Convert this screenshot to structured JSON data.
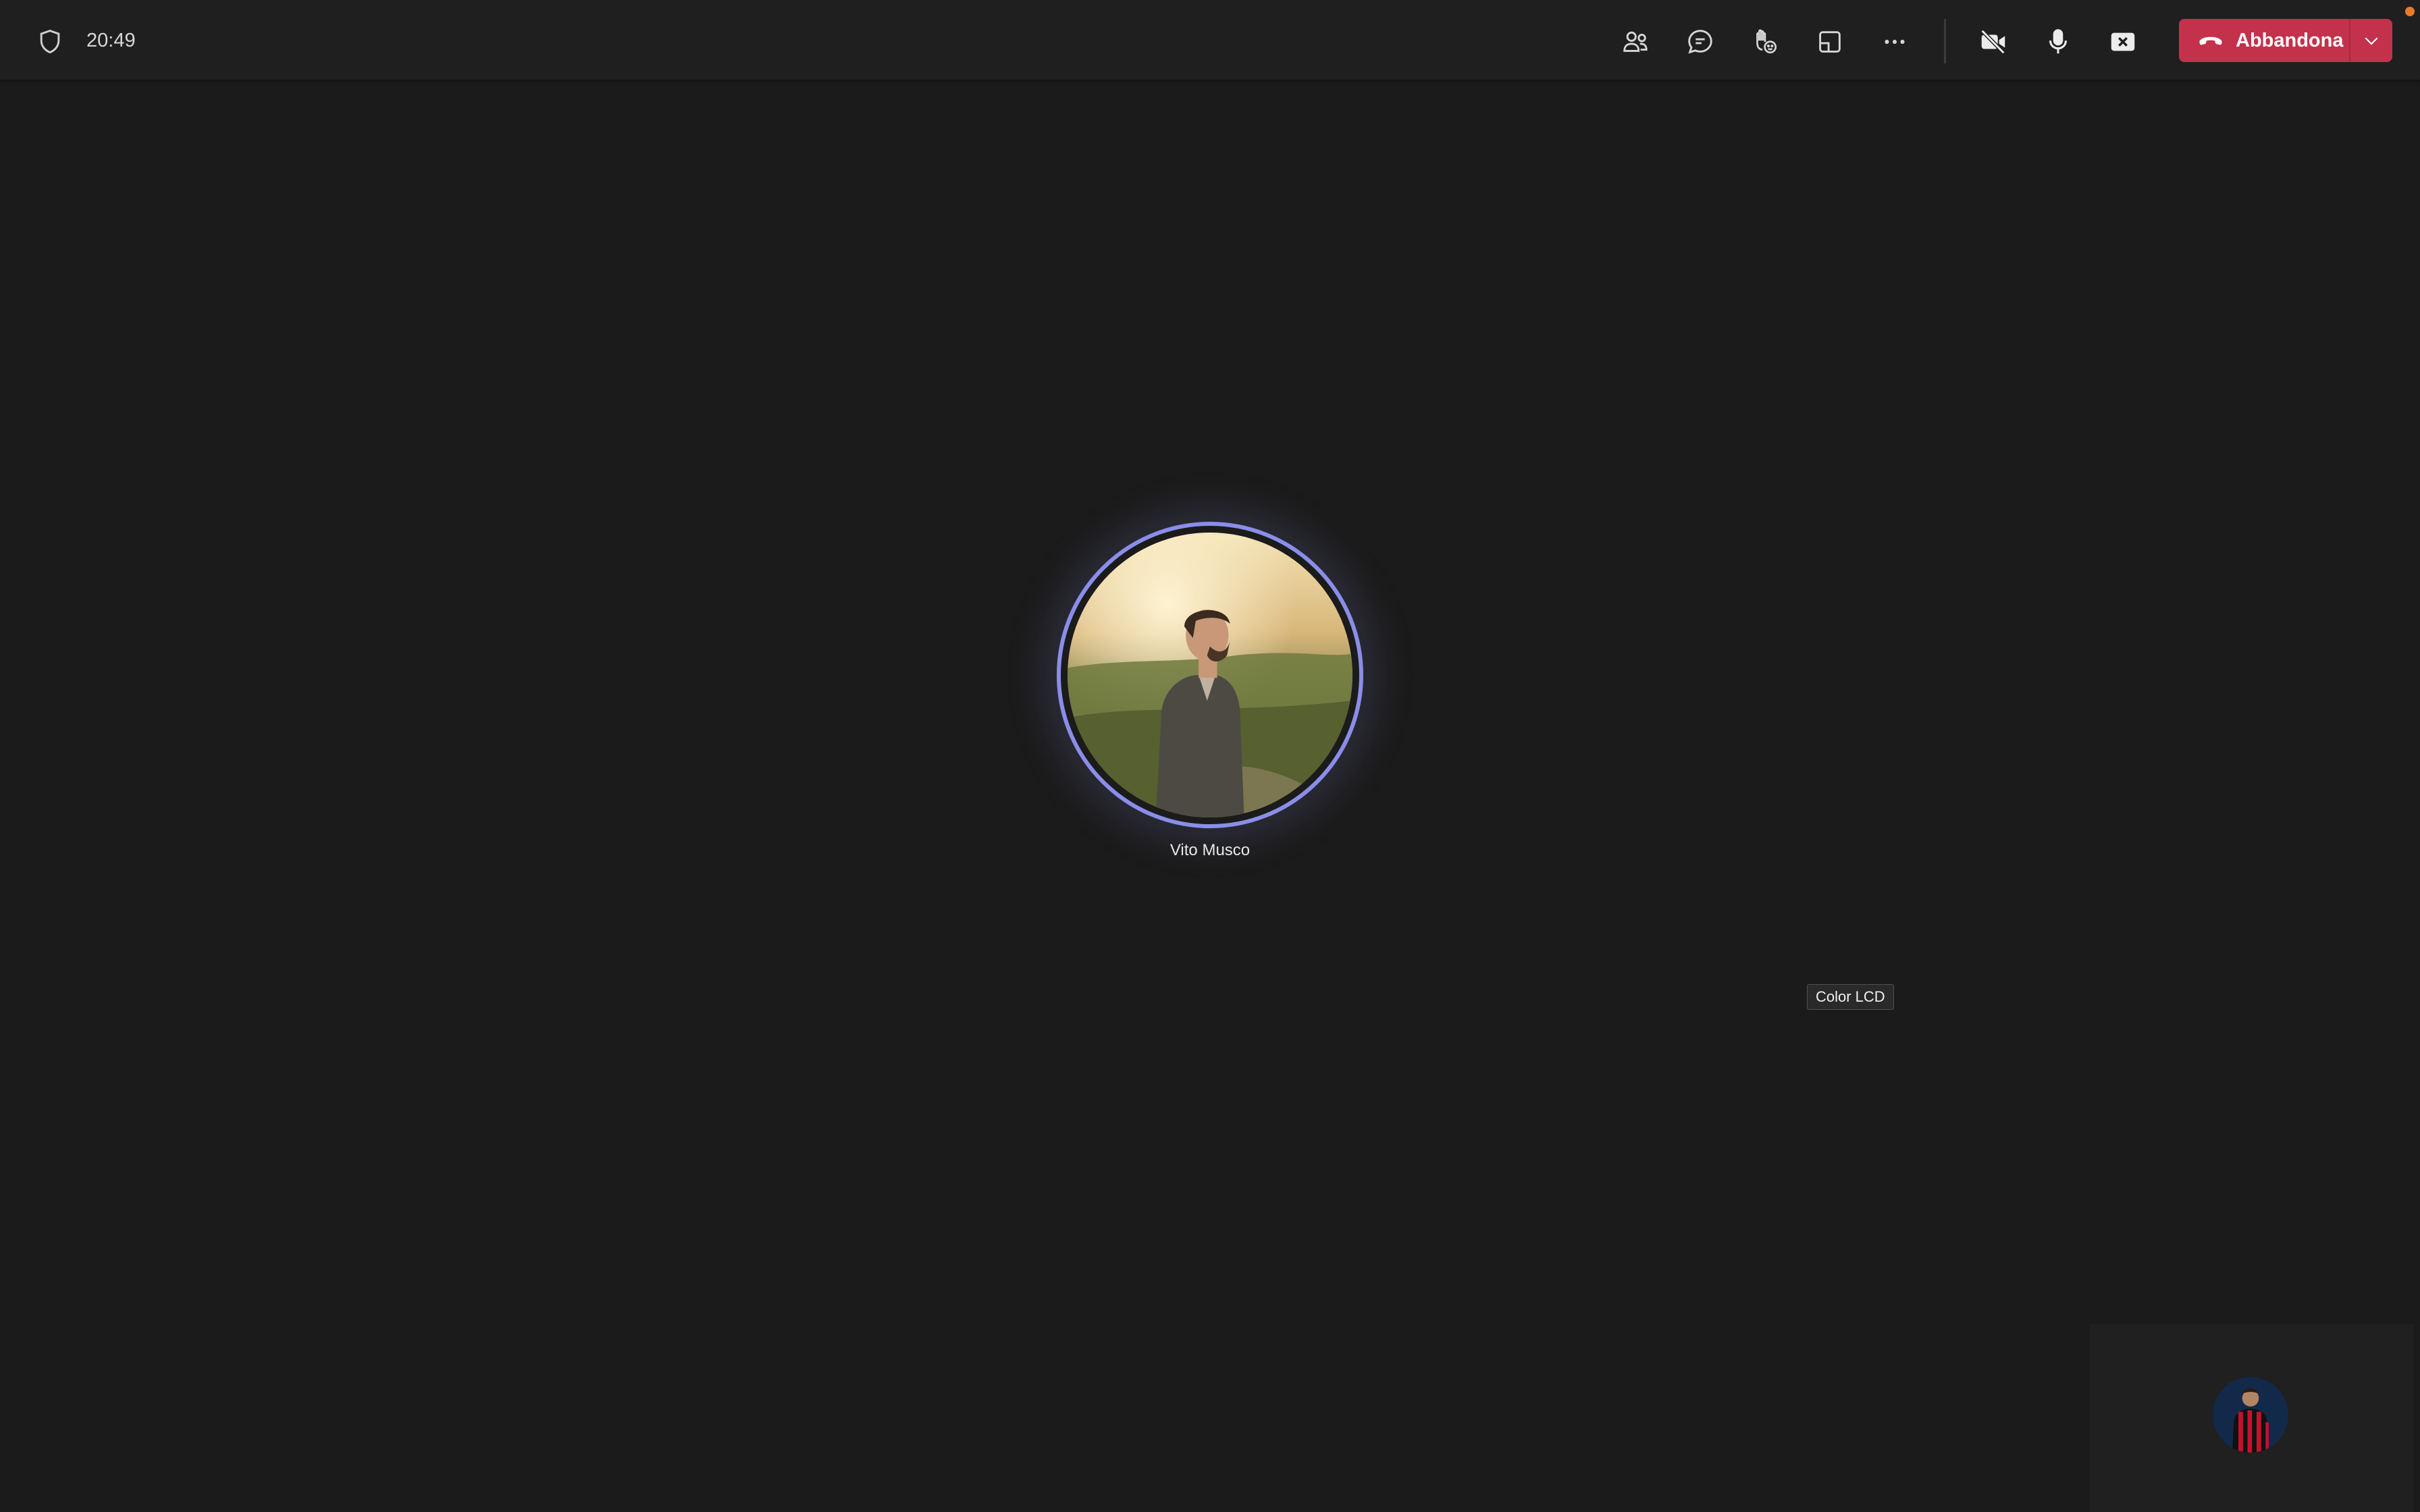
{
  "topbar": {
    "time": "20:49",
    "icons": {
      "security": "shield-icon",
      "people": "people-icon",
      "chat": "chat-icon",
      "react": "raise-hand-react-icon",
      "view": "view-icon",
      "more": "more-icon",
      "camera": "camera-off-icon",
      "mic": "microphone-icon",
      "share": "share-stop-icon"
    },
    "leave_label": "Abbandona"
  },
  "participant": {
    "name": "Vito Musco"
  },
  "tooltip": {
    "text": "Color LCD"
  },
  "colors": {
    "background": "#1b1b1b",
    "topbar": "#1f1f1f",
    "leave_button": "#c4314b",
    "speaking_ring": "#8a8ee8",
    "notification": "#e97b2b"
  }
}
